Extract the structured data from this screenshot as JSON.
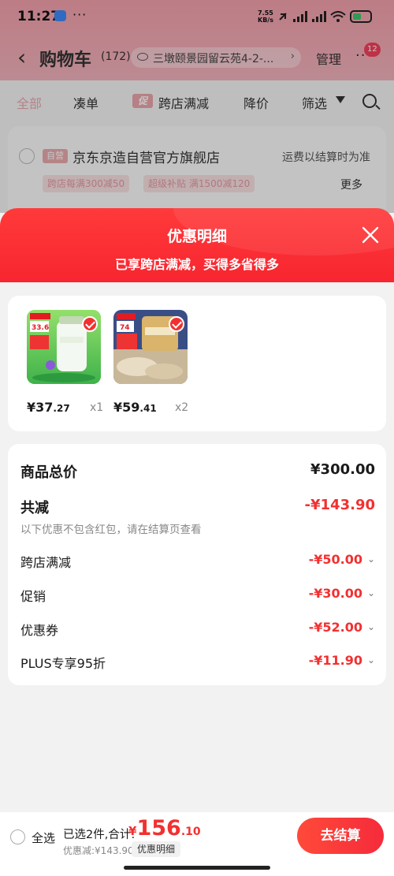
{
  "status_bar": {
    "time": "11:27",
    "net_speed_top": "7.55",
    "net_speed_unit": "KB/s",
    "battery": ""
  },
  "nav": {
    "back_icon": "chevron-left-icon",
    "title": "购物车",
    "count": "(172)",
    "address": "三墩颐景园留云苑4-2-...",
    "manage": "管理",
    "more_badge": "12"
  },
  "filters": {
    "all": "全部",
    "combine": "凑单",
    "promo_tag": "促",
    "cross_store": "跨店满减",
    "price_drop": "降价",
    "filter": "筛选"
  },
  "shop": {
    "self_tag": "自营",
    "name": "京东京造自营官方旗舰店",
    "shipping": "运费以结算时为准",
    "tag1": "跨店每满300减50",
    "tag2": "超级补贴 满1500减120",
    "more": "更多"
  },
  "sheet": {
    "title": "优惠明细",
    "subtitle": "已享跨店满减，买得多省得多"
  },
  "products": [
    {
      "price_int": "¥37",
      "price_dec": ".27",
      "qty": "x1",
      "img_badge": "33.6"
    },
    {
      "price_int": "¥59",
      "price_dec": ".41",
      "qty": "x2",
      "img_badge": "74"
    }
  ],
  "summary": {
    "total_label": "商品总价",
    "total_value": "¥300.00",
    "reduce_label": "共减",
    "reduce_value": "-¥143.90",
    "note": "以下优惠不包含红包，请在结算页查看",
    "items": [
      {
        "label": "跨店满减",
        "value": "-¥50.00"
      },
      {
        "label": "促销",
        "value": "-¥30.00"
      },
      {
        "label": "优惠券",
        "value": "-¥52.00"
      },
      {
        "label": "PLUS专享95折",
        "value": "-¥11.90"
      }
    ]
  },
  "bottom": {
    "select_all": "全选",
    "selected_info": "已选2件,合计:",
    "total_symbol": "¥",
    "total_int": "156",
    "total_dec": ".10",
    "discount": "优惠减:¥143.90",
    "detail_btn": "优惠明细",
    "checkout": "去结算"
  },
  "colors": {
    "accent": "#f23030",
    "sheet_header": "#f7242f"
  }
}
